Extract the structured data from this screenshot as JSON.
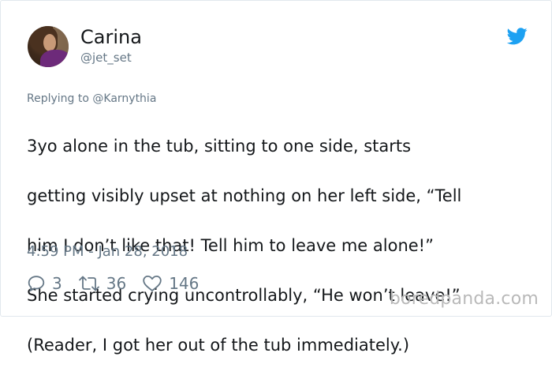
{
  "tweet": {
    "author": {
      "display_name": "Carina",
      "handle": "@jet_set"
    },
    "replying_to": {
      "prefix": "Replying to",
      "handle": "@Karnythia"
    },
    "text_lines": [
      "3yo alone in the tub, sitting to one side, starts",
      "getting visibly upset at nothing on her left side, “Tell",
      "him I don’t like that! Tell him to leave me alone!”",
      "She started crying uncontrollably, “He won’t leave!”",
      "(Reader, I got her out of the tub immediately.)"
    ],
    "timestamp": "4:59 PM - Jan 28, 2018",
    "stats": {
      "replies": "3",
      "retweets": "36",
      "likes": "146"
    }
  },
  "icons": {
    "brand": "twitter-bird-icon",
    "reply": "reply-icon",
    "retweet": "retweet-icon",
    "like": "heart-icon"
  },
  "colors": {
    "brand": "#1da1f2",
    "muted": "#657786",
    "text": "#14171a",
    "watermark": "#b9b9b9"
  },
  "watermark": "boredpanda.com"
}
